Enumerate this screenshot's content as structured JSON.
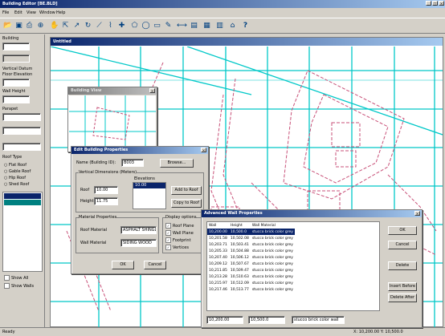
{
  "app": {
    "title": "Building Editor [BE.BLD]",
    "menu": [
      "File",
      "Edit",
      "View",
      "Window",
      "Help"
    ]
  },
  "toolbar_icons": [
    "open-icon",
    "save-icon",
    "print-icon",
    "zoom-icon",
    "pan-icon",
    "select-icon",
    "move-icon",
    "rotate-icon",
    "line-icon",
    "polyline-icon",
    "draw-icon",
    "polygon-icon",
    "circle-icon",
    "node-icon",
    "edit-icon",
    "measure-icon",
    "layer-icon",
    "grid-icon",
    "wall-icon",
    "roof-icon",
    "help-icon"
  ],
  "left_panel": {
    "text1": "Building",
    "text2": "Elevation",
    "text3": "Vertical Datum",
    "text4": "Floor Elevation",
    "text5": "Wall Height",
    "text6": "Parapet",
    "text7": "Roof Type",
    "radio1": "Flat Roof",
    "radio2": "Gable Roof",
    "radio3": "Hip Roof",
    "radio4": "Shed Roof",
    "chk1": "Show All",
    "chk2": "Show Walls"
  },
  "map_window": {
    "title": "Untitled"
  },
  "small_window": {
    "title": "Building View"
  },
  "bldg_dialog": {
    "title": "Edit Building Properties",
    "name_label": "Name (Building ID):",
    "name_value": "B003",
    "browse": "Browse...",
    "group": "Vertical Dimensions (Meters)",
    "roof_label": "Roof",
    "roof_value": "10.00",
    "height_label": "Height",
    "height_value": "11.75",
    "list_header": "Elevations",
    "list_item": "10.00",
    "add_btn": "Add to Roof",
    "copy_btn": "Copy to Roof",
    "material_group": "Material Properties",
    "roof_mat_label": "Roof Material",
    "roof_mat": "ASPHALT SHINGLE",
    "wall_mat_label": "Wall Material",
    "wall_mat": "SIDING WOOD",
    "options_group": "Display options",
    "opt1": "Roof Plane",
    "opt2": "Wall Plane",
    "opt3": "Footprint",
    "opt4": "Vertices",
    "ok": "OK",
    "cancel": "Cancel"
  },
  "wall_dialog": {
    "title": "Advanced Wall Properties",
    "headers": [
      "Wall",
      "Height",
      "Wall Material"
    ],
    "rows": [
      [
        "10,200.00",
        "10,500.0",
        "stucco brick color grey"
      ],
      [
        "10,201.58",
        "10,502.08",
        "stucco brick color grey"
      ],
      [
        "10,203.71",
        "10,503.41",
        "stucco brick color grey"
      ],
      [
        "10,205.33",
        "10,504.88",
        "stucco brick color grey"
      ],
      [
        "10,207.40",
        "10,506.12",
        "stucco brick color grey"
      ],
      [
        "10,209.12",
        "10,507.67",
        "stucco brick color grey"
      ],
      [
        "10,211.85",
        "10,509.47",
        "stucco brick color grey"
      ],
      [
        "10,213.28",
        "10,510.63",
        "stucco brick color grey"
      ],
      [
        "10,215.97",
        "10,512.09",
        "stucco brick color grey"
      ],
      [
        "10,217.46",
        "10,513.77",
        "stucco brick color grey"
      ]
    ],
    "bottom": [
      "10,200.00",
      "10,500.0",
      "stucco brick color wall"
    ],
    "btns": [
      "OK",
      "Cancel",
      "Delete",
      "Insert Before",
      "Delete After"
    ]
  },
  "status": {
    "left": "Ready",
    "right": "X: 10,200.00  Y: 10,500.0"
  }
}
